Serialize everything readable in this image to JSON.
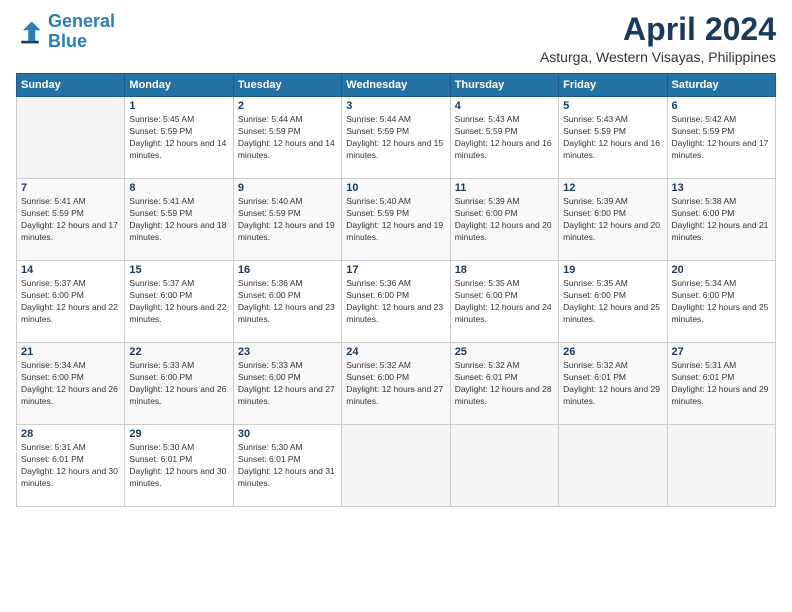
{
  "logo": {
    "line1": "General",
    "line2": "Blue"
  },
  "header": {
    "title": "April 2024",
    "location": "Asturga, Western Visayas, Philippines"
  },
  "days_of_week": [
    "Sunday",
    "Monday",
    "Tuesday",
    "Wednesday",
    "Thursday",
    "Friday",
    "Saturday"
  ],
  "weeks": [
    [
      {
        "day": "",
        "sunrise": "",
        "sunset": "",
        "daylight": ""
      },
      {
        "day": "1",
        "sunrise": "Sunrise: 5:45 AM",
        "sunset": "Sunset: 5:59 PM",
        "daylight": "Daylight: 12 hours and 14 minutes."
      },
      {
        "day": "2",
        "sunrise": "Sunrise: 5:44 AM",
        "sunset": "Sunset: 5:59 PM",
        "daylight": "Daylight: 12 hours and 14 minutes."
      },
      {
        "day": "3",
        "sunrise": "Sunrise: 5:44 AM",
        "sunset": "Sunset: 5:59 PM",
        "daylight": "Daylight: 12 hours and 15 minutes."
      },
      {
        "day": "4",
        "sunrise": "Sunrise: 5:43 AM",
        "sunset": "Sunset: 5:59 PM",
        "daylight": "Daylight: 12 hours and 16 minutes."
      },
      {
        "day": "5",
        "sunrise": "Sunrise: 5:43 AM",
        "sunset": "Sunset: 5:59 PM",
        "daylight": "Daylight: 12 hours and 16 minutes."
      },
      {
        "day": "6",
        "sunrise": "Sunrise: 5:42 AM",
        "sunset": "Sunset: 5:59 PM",
        "daylight": "Daylight: 12 hours and 17 minutes."
      }
    ],
    [
      {
        "day": "7",
        "sunrise": "Sunrise: 5:41 AM",
        "sunset": "Sunset: 5:59 PM",
        "daylight": "Daylight: 12 hours and 17 minutes."
      },
      {
        "day": "8",
        "sunrise": "Sunrise: 5:41 AM",
        "sunset": "Sunset: 5:59 PM",
        "daylight": "Daylight: 12 hours and 18 minutes."
      },
      {
        "day": "9",
        "sunrise": "Sunrise: 5:40 AM",
        "sunset": "Sunset: 5:59 PM",
        "daylight": "Daylight: 12 hours and 19 minutes."
      },
      {
        "day": "10",
        "sunrise": "Sunrise: 5:40 AM",
        "sunset": "Sunset: 5:59 PM",
        "daylight": "Daylight: 12 hours and 19 minutes."
      },
      {
        "day": "11",
        "sunrise": "Sunrise: 5:39 AM",
        "sunset": "Sunset: 6:00 PM",
        "daylight": "Daylight: 12 hours and 20 minutes."
      },
      {
        "day": "12",
        "sunrise": "Sunrise: 5:39 AM",
        "sunset": "Sunset: 6:00 PM",
        "daylight": "Daylight: 12 hours and 20 minutes."
      },
      {
        "day": "13",
        "sunrise": "Sunrise: 5:38 AM",
        "sunset": "Sunset: 6:00 PM",
        "daylight": "Daylight: 12 hours and 21 minutes."
      }
    ],
    [
      {
        "day": "14",
        "sunrise": "Sunrise: 5:37 AM",
        "sunset": "Sunset: 6:00 PM",
        "daylight": "Daylight: 12 hours and 22 minutes."
      },
      {
        "day": "15",
        "sunrise": "Sunrise: 5:37 AM",
        "sunset": "Sunset: 6:00 PM",
        "daylight": "Daylight: 12 hours and 22 minutes."
      },
      {
        "day": "16",
        "sunrise": "Sunrise: 5:36 AM",
        "sunset": "Sunset: 6:00 PM",
        "daylight": "Daylight: 12 hours and 23 minutes."
      },
      {
        "day": "17",
        "sunrise": "Sunrise: 5:36 AM",
        "sunset": "Sunset: 6:00 PM",
        "daylight": "Daylight: 12 hours and 23 minutes."
      },
      {
        "day": "18",
        "sunrise": "Sunrise: 5:35 AM",
        "sunset": "Sunset: 6:00 PM",
        "daylight": "Daylight: 12 hours and 24 minutes."
      },
      {
        "day": "19",
        "sunrise": "Sunrise: 5:35 AM",
        "sunset": "Sunset: 6:00 PM",
        "daylight": "Daylight: 12 hours and 25 minutes."
      },
      {
        "day": "20",
        "sunrise": "Sunrise: 5:34 AM",
        "sunset": "Sunset: 6:00 PM",
        "daylight": "Daylight: 12 hours and 25 minutes."
      }
    ],
    [
      {
        "day": "21",
        "sunrise": "Sunrise: 5:34 AM",
        "sunset": "Sunset: 6:00 PM",
        "daylight": "Daylight: 12 hours and 26 minutes."
      },
      {
        "day": "22",
        "sunrise": "Sunrise: 5:33 AM",
        "sunset": "Sunset: 6:00 PM",
        "daylight": "Daylight: 12 hours and 26 minutes."
      },
      {
        "day": "23",
        "sunrise": "Sunrise: 5:33 AM",
        "sunset": "Sunset: 6:00 PM",
        "daylight": "Daylight: 12 hours and 27 minutes."
      },
      {
        "day": "24",
        "sunrise": "Sunrise: 5:32 AM",
        "sunset": "Sunset: 6:00 PM",
        "daylight": "Daylight: 12 hours and 27 minutes."
      },
      {
        "day": "25",
        "sunrise": "Sunrise: 5:32 AM",
        "sunset": "Sunset: 6:01 PM",
        "daylight": "Daylight: 12 hours and 28 minutes."
      },
      {
        "day": "26",
        "sunrise": "Sunrise: 5:32 AM",
        "sunset": "Sunset: 6:01 PM",
        "daylight": "Daylight: 12 hours and 29 minutes."
      },
      {
        "day": "27",
        "sunrise": "Sunrise: 5:31 AM",
        "sunset": "Sunset: 6:01 PM",
        "daylight": "Daylight: 12 hours and 29 minutes."
      }
    ],
    [
      {
        "day": "28",
        "sunrise": "Sunrise: 5:31 AM",
        "sunset": "Sunset: 6:01 PM",
        "daylight": "Daylight: 12 hours and 30 minutes."
      },
      {
        "day": "29",
        "sunrise": "Sunrise: 5:30 AM",
        "sunset": "Sunset: 6:01 PM",
        "daylight": "Daylight: 12 hours and 30 minutes."
      },
      {
        "day": "30",
        "sunrise": "Sunrise: 5:30 AM",
        "sunset": "Sunset: 6:01 PM",
        "daylight": "Daylight: 12 hours and 31 minutes."
      },
      {
        "day": "",
        "sunrise": "",
        "sunset": "",
        "daylight": ""
      },
      {
        "day": "",
        "sunrise": "",
        "sunset": "",
        "daylight": ""
      },
      {
        "day": "",
        "sunrise": "",
        "sunset": "",
        "daylight": ""
      },
      {
        "day": "",
        "sunrise": "",
        "sunset": "",
        "daylight": ""
      }
    ]
  ]
}
